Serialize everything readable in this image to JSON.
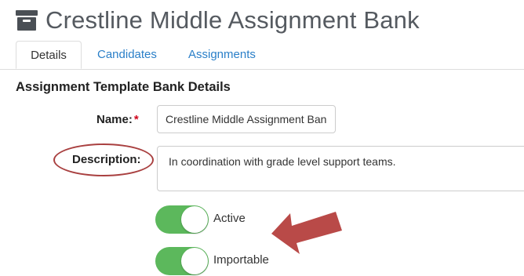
{
  "header": {
    "title": "Crestline Middle Assignment Bank",
    "icon": "archive-box-icon"
  },
  "tabs": [
    {
      "label": "Details",
      "active": true
    },
    {
      "label": "Candidates",
      "active": false
    },
    {
      "label": "Assignments",
      "active": false
    }
  ],
  "section": {
    "heading": "Assignment Template Bank Details"
  },
  "form": {
    "name_label": "Name:",
    "required_marker": "*",
    "name_value": "Crestline Middle Assignment Bank",
    "description_label": "Description:",
    "description_value": "In coordination with grade level support teams.",
    "active_label": "Active",
    "active_on": true,
    "importable_label": "Importable",
    "importable_on": true
  },
  "colors": {
    "accent_link": "#2a7fc8",
    "toggle_on": "#5cb85c",
    "required": "#d0021b",
    "annotation": "#b94a48"
  },
  "annotations": {
    "ellipse_target": "description-label",
    "arrow_target": "toggles"
  }
}
